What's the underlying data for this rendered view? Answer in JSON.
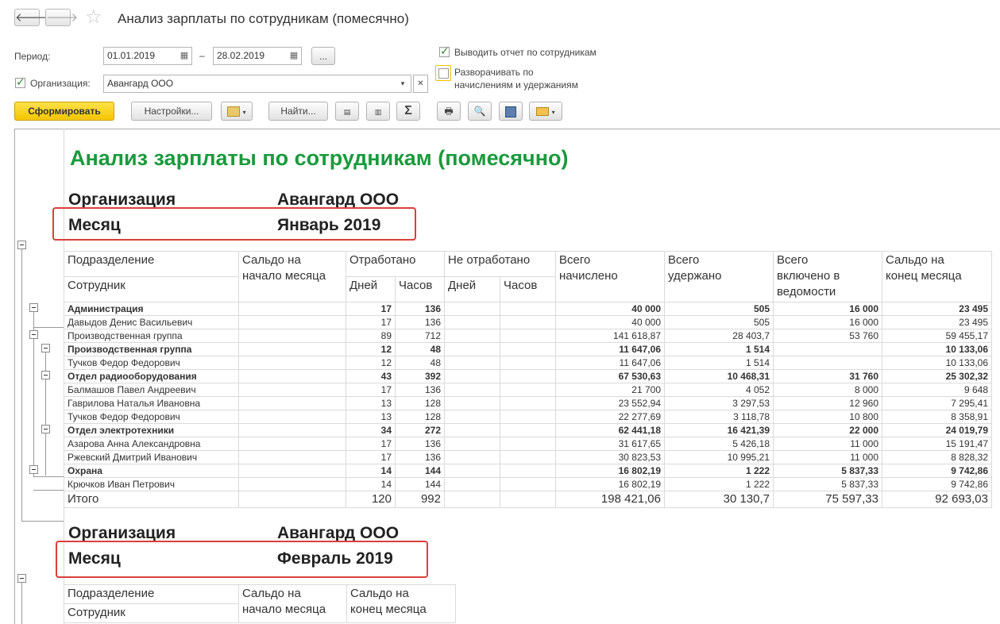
{
  "window": {
    "title": "Анализ зарплаты по сотрудникам (помесячно)",
    "back_icon": "arrow-left-icon",
    "forward_icon": "arrow-right-icon",
    "favorite_icon": "star-icon"
  },
  "params": {
    "period_label": "Период:",
    "date_from": "01.01.2019",
    "dash": "–",
    "date_to": "28.02.2019",
    "more_button": "...",
    "org_label": "Организация:",
    "org_value": "Авангард ООО",
    "show_employees_label": "Выводить отчет по сотрудникам",
    "show_employees_checked": true,
    "expand_label_line1": "Разворачивать по",
    "expand_label_line2": "начислениям и удержаниям",
    "expand_checked": false
  },
  "toolbar": {
    "generate": "Сформировать",
    "settings": "Настройки...",
    "find": "Найти...",
    "sum": "Σ"
  },
  "report": {
    "title": "Анализ зарплаты по сотрудникам (помесячно)",
    "org_key": "Организация",
    "org_value": "Авангард ООО",
    "month_key": "Месяц",
    "month1": "Январь 2019",
    "month2": "Февраль 2019",
    "headers": {
      "dept": "Подразделение",
      "employee": "Сотрудник",
      "start_balance_1": "Сальдо на",
      "start_balance_2": "начало месяца",
      "worked": "Отработано",
      "not_worked": "Не отработано",
      "days": "Дней",
      "hours": "Часов",
      "accrued_1": "Всего",
      "accrued_2": "начислено",
      "withheld_1": "Всего",
      "withheld_2": "удержано",
      "included_1": "Всего",
      "included_2": "включено в",
      "included_3": "ведомости",
      "end_balance_1": "Сальдо на",
      "end_balance_2": "конец месяца"
    },
    "rows": [
      {
        "name": "Администрация",
        "bold": true,
        "days": "17",
        "hours": "136",
        "accrued": "40 000",
        "withheld": "505",
        "included": "16 000",
        "end": "23 495"
      },
      {
        "name": "Давыдов Денис Васильевич",
        "bold": false,
        "days": "17",
        "hours": "136",
        "accrued": "40 000",
        "withheld": "505",
        "included": "16 000",
        "end": "23 495"
      },
      {
        "name": "Производственная группа",
        "bold": false,
        "days": "89",
        "hours": "712",
        "accrued": "141 618,87",
        "withheld": "28 403,7",
        "included": "53 760",
        "end": "59 455,17"
      },
      {
        "name": "Производственная группа",
        "bold": true,
        "days": "12",
        "hours": "48",
        "accrued": "11 647,06",
        "withheld": "1 514",
        "included": "",
        "end": "10 133,06"
      },
      {
        "name": "Тучков Федор Федорович",
        "bold": false,
        "days": "12",
        "hours": "48",
        "accrued": "11 647,06",
        "withheld": "1 514",
        "included": "",
        "end": "10 133,06"
      },
      {
        "name": "Отдел радиооборудования",
        "bold": true,
        "days": "43",
        "hours": "392",
        "accrued": "67 530,63",
        "withheld": "10 468,31",
        "included": "31 760",
        "end": "25 302,32"
      },
      {
        "name": "Балмашов Павел Андреевич",
        "bold": false,
        "days": "17",
        "hours": "136",
        "accrued": "21 700",
        "withheld": "4 052",
        "included": "8 000",
        "end": "9 648"
      },
      {
        "name": "Гаврилова Наталья Ивановна",
        "bold": false,
        "days": "13",
        "hours": "128",
        "accrued": "23 552,94",
        "withheld": "3 297,53",
        "included": "12 960",
        "end": "7 295,41"
      },
      {
        "name": "Тучков Федор Федорович",
        "bold": false,
        "days": "13",
        "hours": "128",
        "accrued": "22 277,69",
        "withheld": "3 118,78",
        "included": "10 800",
        "end": "8 358,91"
      },
      {
        "name": "Отдел электротехники",
        "bold": true,
        "days": "34",
        "hours": "272",
        "accrued": "62 441,18",
        "withheld": "16 421,39",
        "included": "22 000",
        "end": "24 019,79"
      },
      {
        "name": "Азарова Анна Александровна",
        "bold": false,
        "days": "17",
        "hours": "136",
        "accrued": "31 617,65",
        "withheld": "5 426,18",
        "included": "11 000",
        "end": "15 191,47"
      },
      {
        "name": "Ржевский Дмитрий Иванович",
        "bold": false,
        "days": "17",
        "hours": "136",
        "accrued": "30 823,53",
        "withheld": "10 995,21",
        "included": "11 000",
        "end": "8 828,32"
      },
      {
        "name": "Охрана",
        "bold": true,
        "days": "14",
        "hours": "144",
        "accrued": "16 802,19",
        "withheld": "1 222",
        "included": "5 837,33",
        "end": "9 742,86"
      },
      {
        "name": "Крючков Иван Петрович",
        "bold": false,
        "days": "14",
        "hours": "144",
        "accrued": "16 802,19",
        "withheld": "1 222",
        "included": "5 837,33",
        "end": "9 742,86"
      }
    ],
    "total": {
      "name": "Итого",
      "days": "120",
      "hours": "992",
      "accrued": "198 421,06",
      "withheld": "30 130,7",
      "included": "75 597,33",
      "end": "92 693,03"
    }
  }
}
